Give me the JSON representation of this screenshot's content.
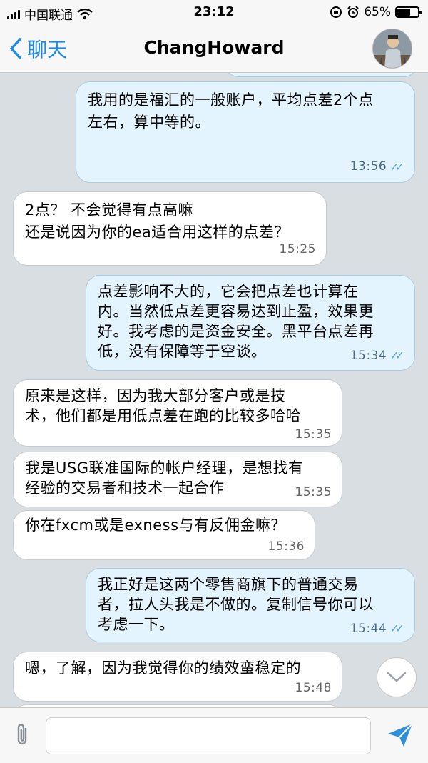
{
  "status": {
    "carrier": "中国联通",
    "time": "23:12",
    "battery": "65%",
    "battery_level": 0.65
  },
  "nav": {
    "back_label": "聊天",
    "title": "ChangHoward"
  },
  "messages": [
    {
      "dir": "out",
      "text": "我用的是福汇的一般账户，平均点差2个点\n左右，算中等的。",
      "time": "13:56",
      "read": true
    },
    {
      "dir": "in",
      "text": "2点？ 不会觉得有点高嘛\n还是说因为你的ea适合用这样的点差？",
      "time": "15:25"
    },
    {
      "dir": "out",
      "text": "点差影响不大的，它会把点差也计算在\n内。当然低点差更容易达到止盈，效果更\n好。我考虑的是资金安全。黑平台点差再\n低，没有保障等于空谈。",
      "time": "15:34",
      "read": true
    },
    {
      "dir": "in",
      "text": "原来是这样，因为我大部分客户或是技\n术，他们都是用低点差在跑的比较多哈哈",
      "time": "15:35"
    },
    {
      "dir": "in",
      "text": "我是USG联准国际的帐户经理，是想找有\n经验的交易者和技术一起合作",
      "time": "15:35"
    },
    {
      "dir": "in",
      "text": "你在fxcm或是exness与有反佣金嘛？",
      "time": "15:36"
    },
    {
      "dir": "out",
      "text": "我正好是这两个零售商旗下的普通交易\n者，拉人头我是不做的。复制信号你可以\n考虑一下。",
      "time": "15:44",
      "read": true
    },
    {
      "dir": "in",
      "text": "嗯，了解，因为我觉得你的绩效蛮稳定的",
      "time": "15:48"
    }
  ],
  "input": {
    "value": "",
    "placeholder": ""
  },
  "colors": {
    "accent": "#1e8ae0",
    "outgoing_bubble": "#e4f4ff",
    "incoming_bubble": "#ffffff",
    "chat_background": "#d9dee3"
  },
  "icons": {
    "attach": "paperclip-icon",
    "send": "send-icon",
    "scroll": "chevron-down-icon",
    "back": "chevron-left-icon"
  }
}
